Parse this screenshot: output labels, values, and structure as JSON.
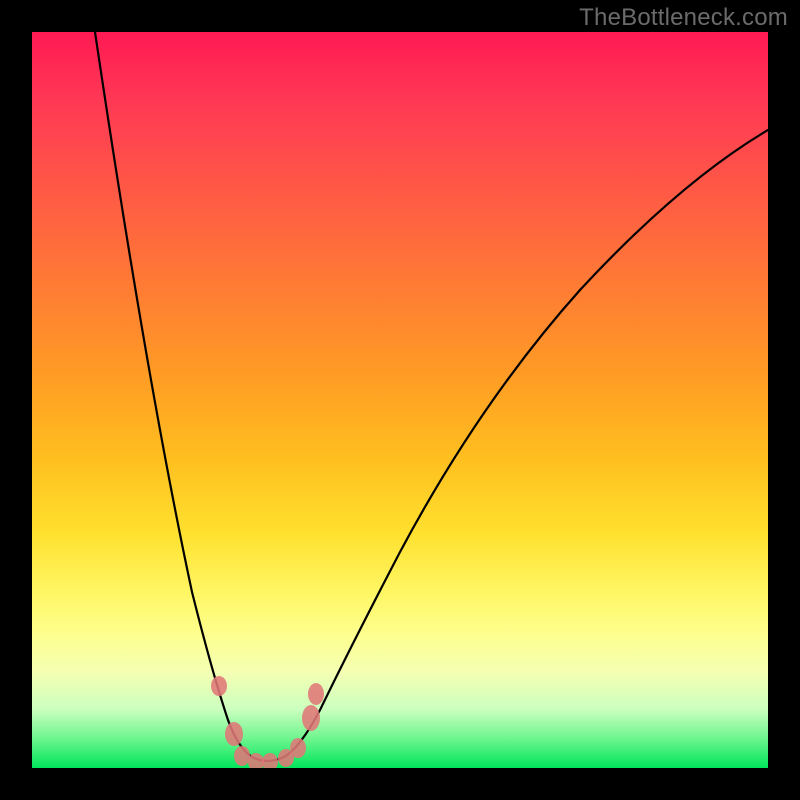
{
  "watermark": "TheBottleneck.com",
  "chart_data": {
    "type": "line",
    "title": "",
    "xlabel": "",
    "ylabel": "",
    "xlim": [
      0,
      100
    ],
    "ylim": [
      0,
      100
    ],
    "grid": false,
    "legend": false,
    "description": "Bottleneck V-shaped curve over a vertical color gradient (red at top = high bottleneck, green at bottom = optimal). Curve reaches its minimum near x≈30. A cluster of salmon dots sits along the trough of the curve.",
    "gradient_stops": [
      {
        "pos": 0,
        "color": "#ff1a53"
      },
      {
        "pos": 10,
        "color": "#ff3a54"
      },
      {
        "pos": 22,
        "color": "#ff5a45"
      },
      {
        "pos": 34,
        "color": "#ff7a35"
      },
      {
        "pos": 46,
        "color": "#ff9a25"
      },
      {
        "pos": 58,
        "color": "#ffbf1f"
      },
      {
        "pos": 68,
        "color": "#ffe02e"
      },
      {
        "pos": 76,
        "color": "#fff663"
      },
      {
        "pos": 82,
        "color": "#fdff8f"
      },
      {
        "pos": 87,
        "color": "#f4ffb3"
      },
      {
        "pos": 92,
        "color": "#ccffbf"
      },
      {
        "pos": 96,
        "color": "#6df58e"
      },
      {
        "pos": 100,
        "color": "#00e55b"
      }
    ],
    "series": [
      {
        "name": "bottleneck-curve",
        "x": [
          8,
          14,
          20,
          24,
          27,
          30,
          34,
          38,
          44,
          54,
          66,
          80,
          100
        ],
        "y": [
          100,
          70,
          40,
          24,
          10,
          2,
          1,
          6,
          18,
          34,
          55,
          74,
          87
        ]
      }
    ],
    "dots": {
      "name": "highlighted-points",
      "color": "#e07878",
      "points": [
        {
          "x": 25,
          "y": 11
        },
        {
          "x": 27,
          "y": 5
        },
        {
          "x": 28.5,
          "y": 2
        },
        {
          "x": 30,
          "y": 1
        },
        {
          "x": 32,
          "y": 1
        },
        {
          "x": 34.5,
          "y": 1.5
        },
        {
          "x": 36,
          "y": 3
        },
        {
          "x": 38,
          "y": 7
        },
        {
          "x": 39,
          "y": 10
        }
      ]
    }
  }
}
